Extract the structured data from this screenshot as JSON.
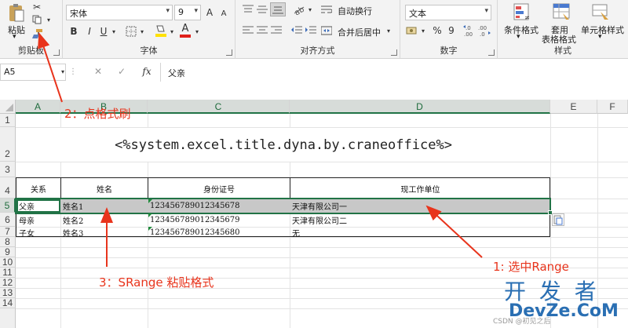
{
  "ribbon": {
    "clipboard": {
      "paste_label": "粘贴",
      "group_label": "剪贴板"
    },
    "font": {
      "font_name": "宋体",
      "font_size": "9",
      "bold": "B",
      "italic": "I",
      "underline": "U",
      "color_letter": "A",
      "grow": "A",
      "shrink": "A",
      "group_label": "字体"
    },
    "alignment": {
      "wrap_label": "自动换行",
      "merge_label": "合并后居中",
      "group_label": "对齐方式"
    },
    "number": {
      "format": "文本",
      "percent": "%",
      "comma": "9",
      "group_label": "数字"
    },
    "styles": {
      "conditional_label": "条件格式",
      "table_label_1": "套用",
      "table_label_2": "表格格式",
      "cell_styles_label": "单元格样式",
      "group_label": "样式"
    }
  },
  "formula_bar": {
    "name_box": "A5",
    "fx": "fx",
    "value": "父亲"
  },
  "sheet": {
    "columns": [
      "A",
      "B",
      "C",
      "D",
      "E",
      "F"
    ],
    "rows": [
      "1",
      "2",
      "3",
      "4",
      "5",
      "6",
      "7",
      "8",
      "9",
      "10",
      "11",
      "12",
      "13",
      "14"
    ],
    "title": "<%system.excel.title.dyna.by.craneoffice%>",
    "headers": [
      "关系",
      "姓名",
      "身份证号",
      "现工作单位"
    ],
    "data": [
      [
        "父亲",
        "姓名1",
        "123456789012345678",
        "天津有限公司一"
      ],
      [
        "母亲",
        "姓名2",
        "123456789012345679",
        "天津有限公司二"
      ],
      [
        "子女",
        "姓名3",
        "123456789012345680",
        "无"
      ]
    ]
  },
  "annotations": {
    "step1": "1: 选中Range",
    "step2": "2：点格式刷",
    "step3": "3：SRange 粘贴格式"
  },
  "watermark": {
    "logo_top": "开 发 者",
    "logo_bottom": "DevZe.CoM",
    "csdn": "CSDN @初见之后"
  },
  "colors": {
    "arrow": "#e8341c",
    "excel_green": "#217346",
    "selection_fill": "#c8c8c8"
  }
}
